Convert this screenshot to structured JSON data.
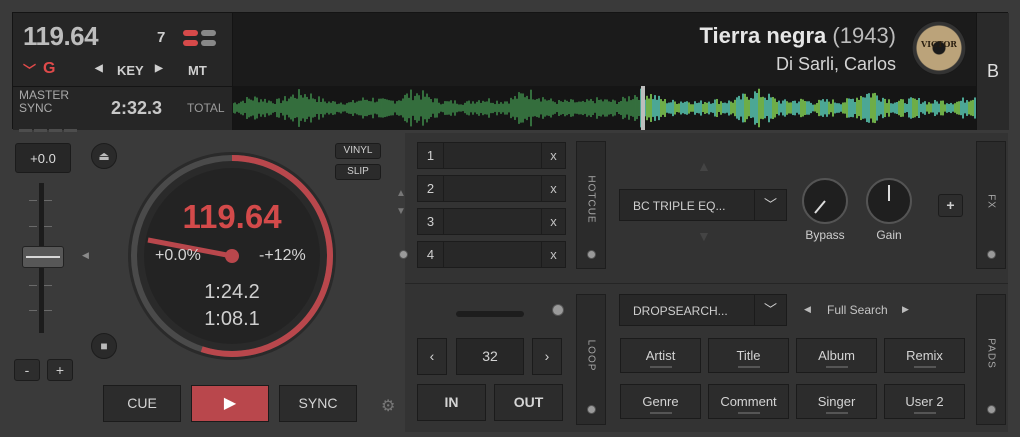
{
  "deck": {
    "bpm": "119.64",
    "key_count": "7",
    "key_value": "G",
    "key_label": "KEY",
    "mt_label": "MT",
    "master_label": "MASTER",
    "sync_label": "SYNC",
    "total_time": "2:32.3",
    "total_label": "TOTAL",
    "deck_letter": "B"
  },
  "track": {
    "title": "Tierra negra",
    "year": "(1943)",
    "artist": "Di Sarli, Carlos",
    "logo_text": "VICTOR"
  },
  "pitch": {
    "value": "+0.0",
    "minus_label": "-",
    "plus_label": "+"
  },
  "jog": {
    "bpm": "119.64",
    "pitch_offset": "+0.0%",
    "pitch_range": "-+12%",
    "elapsed": "1:24.2",
    "remaining": "1:08.1",
    "progress": 0.55
  },
  "buttons": {
    "vinyl": "VINYL",
    "slip": "SLIP",
    "cue": "CUE",
    "play": "▶",
    "sync": "SYNC"
  },
  "hotcues": {
    "tab_label": "HOTCUE",
    "slots": [
      {
        "num": "1",
        "x": "x"
      },
      {
        "num": "2",
        "x": "x"
      },
      {
        "num": "3",
        "x": "x"
      },
      {
        "num": "4",
        "x": "x"
      }
    ]
  },
  "fx": {
    "effect_name": "BC TRIPLE EQ...",
    "bypass_label": "Bypass",
    "gain_label": "Gain",
    "add_label": "+",
    "tab_label": "FX"
  },
  "loop": {
    "tab_label": "LOOP",
    "length": "32",
    "prev": "‹",
    "next": "›",
    "in_label": "IN",
    "out_label": "OUT"
  },
  "pads": {
    "tab_label": "PADS",
    "dropdown": "DROPSEARCH...",
    "mode_label": "Full Search",
    "buttons": [
      "Artist",
      "Title",
      "Album",
      "Remix",
      "Genre",
      "Comment",
      "Singer",
      "User 2"
    ]
  },
  "colors": {
    "accent_red": "#b9474c",
    "bpm_red": "#d34a4a",
    "wave_green": "#4fae5a",
    "wave_teal": "#5fd8c0"
  }
}
